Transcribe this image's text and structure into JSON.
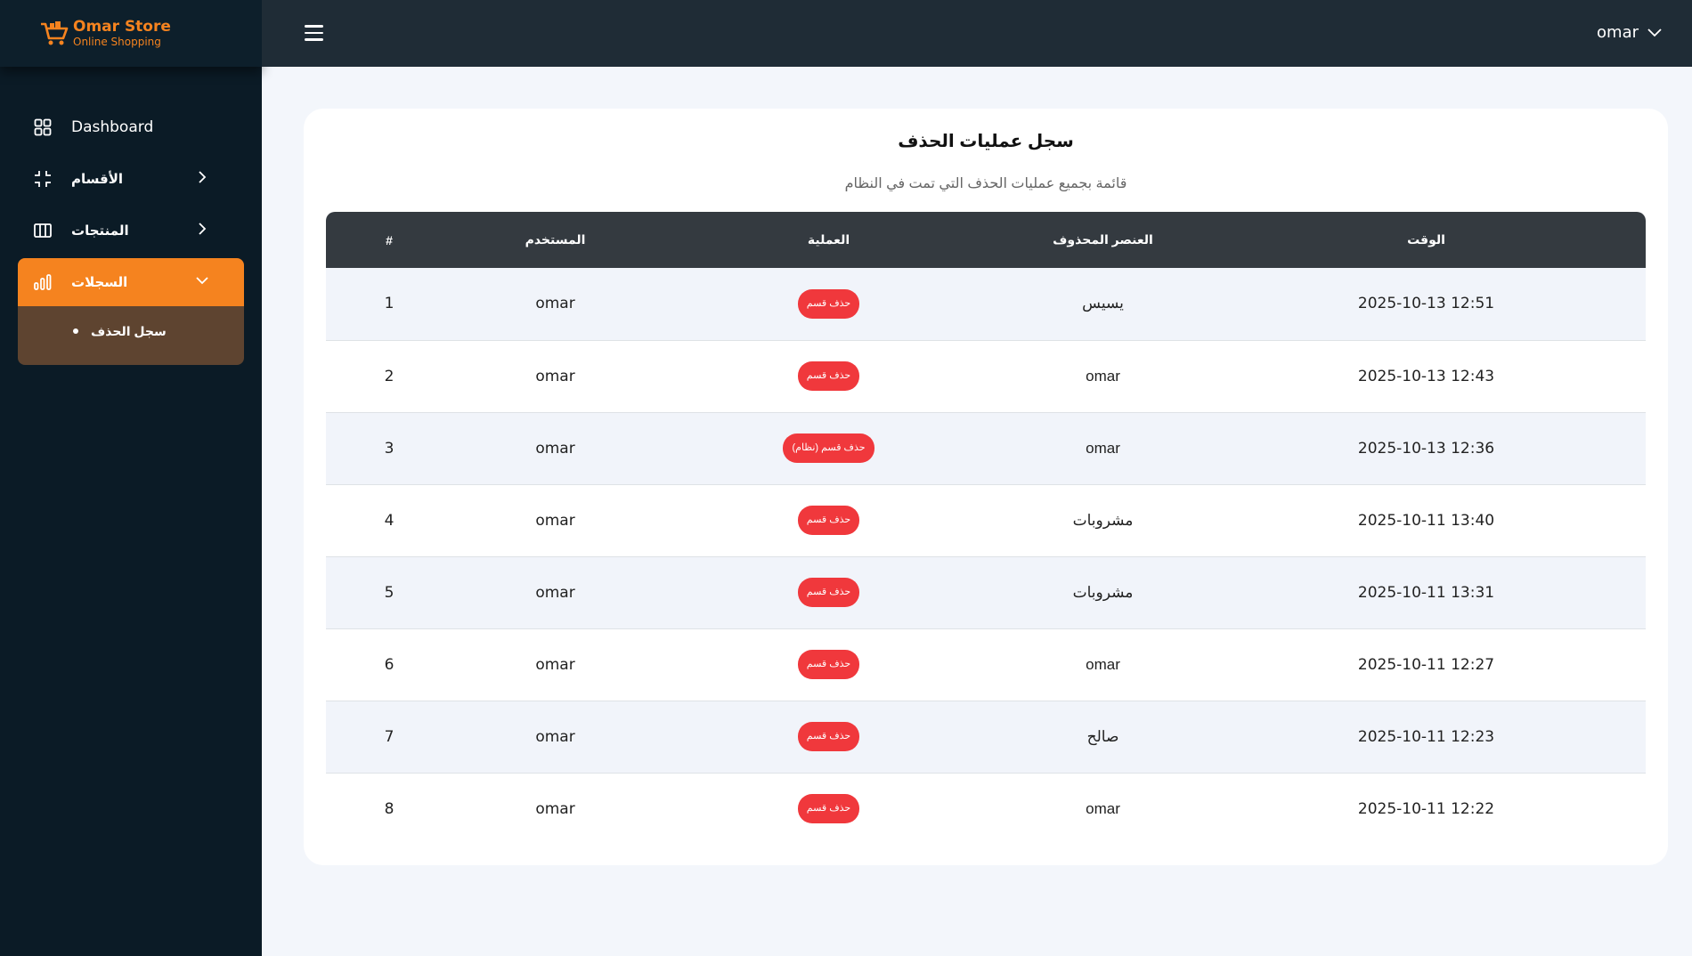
{
  "brand": {
    "name": "Omar Store",
    "tagline": "Online Shopping",
    "color": "#f5831f"
  },
  "sidebar": {
    "items": [
      {
        "label": "Dashboard",
        "icon": "grid-icon"
      },
      {
        "label": "الأقسام",
        "icon": "collapse-icon"
      },
      {
        "label": "المنتجات",
        "icon": "columns-icon"
      },
      {
        "label": "السجلات",
        "icon": "bar-chart-icon",
        "active": true
      }
    ],
    "submenu": [
      {
        "label": "سجل الحذف"
      }
    ]
  },
  "topbar": {
    "user": "omar"
  },
  "page": {
    "title": "سجل عمليات الحذف",
    "subtitle": "قائمة بجميع عمليات الحذف التي تمت في النظام"
  },
  "table": {
    "headers": {
      "index": "#",
      "user": "المستخدم",
      "operation": "العملية",
      "item": "العنصر المحذوف",
      "time": "الوقت"
    },
    "rows": [
      {
        "index": "1",
        "user": "omar",
        "operation": "حذف قسم",
        "item": "يسيس",
        "time": "2025-10-13 12:51"
      },
      {
        "index": "2",
        "user": "omar",
        "operation": "حذف قسم",
        "item": "omar",
        "time": "2025-10-13 12:43"
      },
      {
        "index": "3",
        "user": "omar",
        "operation": "حذف قسم (نظام)",
        "item": "omar",
        "time": "2025-10-13 12:36"
      },
      {
        "index": "4",
        "user": "omar",
        "operation": "حذف قسم",
        "item": "مشروبات",
        "time": "2025-10-11 13:40"
      },
      {
        "index": "5",
        "user": "omar",
        "operation": "حذف قسم",
        "item": "مشروبات",
        "time": "2025-10-11 13:31"
      },
      {
        "index": "6",
        "user": "omar",
        "operation": "حذف قسم",
        "item": "omar",
        "time": "2025-10-11 12:27"
      },
      {
        "index": "7",
        "user": "omar",
        "operation": "حذف قسم",
        "item": "صالح",
        "time": "2025-10-11 12:23"
      },
      {
        "index": "8",
        "user": "omar",
        "operation": "حذف قسم",
        "item": "omar",
        "time": "2025-10-11 12:22"
      }
    ]
  },
  "colors": {
    "accent": "#f5831f",
    "sidebar": "#0b1b26",
    "topbar": "#1f2c36",
    "badge": "#f0383c",
    "table_header": "#343a40"
  }
}
